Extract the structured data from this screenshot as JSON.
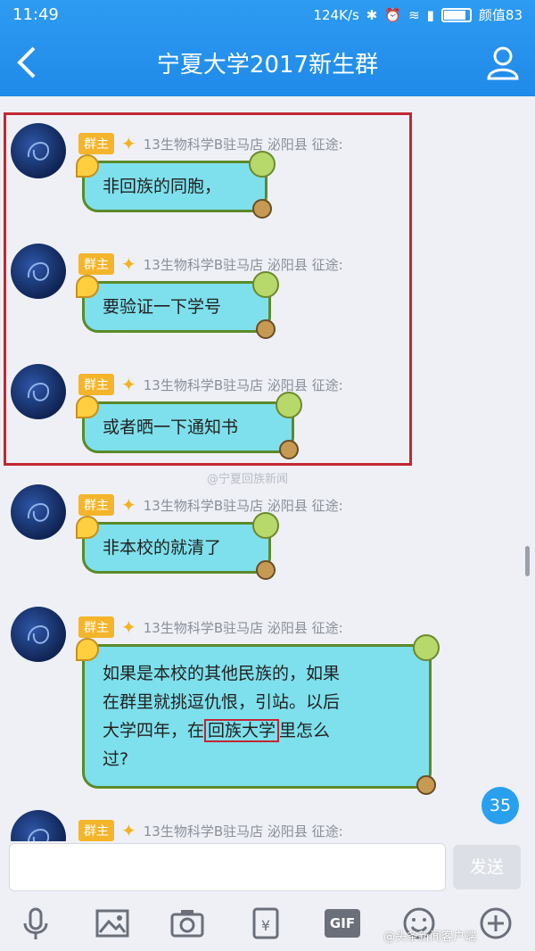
{
  "status_bar": {
    "time": "11:49",
    "net_speed": "124K/s",
    "battery_label": "颜值83"
  },
  "header": {
    "title": "宁夏大学2017新生群",
    "back_icon": "back-chevron-icon",
    "profile_icon": "group-members-icon"
  },
  "messages": [
    {
      "badge": "群主",
      "sender": "13生物科学B驻马店 泌阳县 征途:",
      "text": "非回族的同胞，"
    },
    {
      "badge": "群主",
      "sender": "13生物科学B驻马店 泌阳县 征途:",
      "text": "要验证一下学号"
    },
    {
      "badge": "群主",
      "sender": "13生物科学B驻马店 泌阳县 征途:",
      "text": "或者晒一下通知书"
    },
    {
      "badge": "群主",
      "sender": "13生物科学B驻马店 泌阳县 征途:",
      "text": "非本校的就清了"
    },
    {
      "badge": "群主",
      "sender": "13生物科学B驻马店 泌阳县 征途:",
      "text_line1": "如果是本校的其他民族的，如果",
      "text_line2": "在群里就挑逗仇恨，引站。以后",
      "text_line3_before": "大学四年，在",
      "text_line3_highlight": "回族大学",
      "text_line3_after": "里怎么",
      "text_line4": "过?"
    },
    {
      "badge": "群主",
      "sender": "13生物科学B驻马店 泌阳县 征途:"
    }
  ],
  "watermark_center": "@宁夏回族新闻",
  "unread_count": "35",
  "input": {
    "placeholder": "",
    "send_label": "发送"
  },
  "toolbar": {
    "gif_label": "GIF",
    "icons": [
      "microphone-icon",
      "image-icon",
      "camera-icon",
      "red-packet-icon",
      "gif-icon",
      "emoji-icon",
      "plus-icon"
    ]
  },
  "watermark_bottom": "@头条新闻客户端",
  "colors": {
    "header": "#1f8ae8",
    "bubble": "#7ee0ec",
    "badge": "#f5b52a",
    "highlight_box": "#c12732"
  }
}
